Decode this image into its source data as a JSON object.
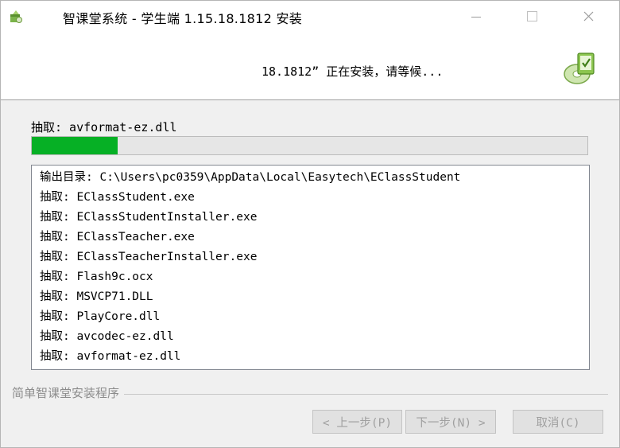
{
  "window": {
    "title": "智课堂系统 - 学生端 1.15.18.1812 安装",
    "icon": "installer-icon"
  },
  "header": {
    "status": "18.1812” 正在安装，请等候...",
    "logo": "install-logo-icon"
  },
  "progress": {
    "label": "抽取: avformat-ez.dll",
    "fraction": 0.155,
    "color": "#06b025"
  },
  "log": {
    "lines": [
      "输出目录: C:\\Users\\pc0359\\AppData\\Local\\Easytech\\EClassStudent",
      "抽取: EClassStudent.exe",
      "抽取: EClassStudentInstaller.exe",
      "抽取: EClassTeacher.exe",
      "抽取: EClassTeacherInstaller.exe",
      "抽取: Flash9c.ocx",
      "抽取: MSVCP71.DLL",
      "抽取: PlayCore.dll",
      "抽取: avcodec-ez.dll",
      "抽取: avformat-ez.dll"
    ]
  },
  "brand": "简单智课堂安装程序",
  "buttons": {
    "back": "< 上一步(P)",
    "next": "下一步(N) >",
    "cancel": "取消(C)"
  }
}
